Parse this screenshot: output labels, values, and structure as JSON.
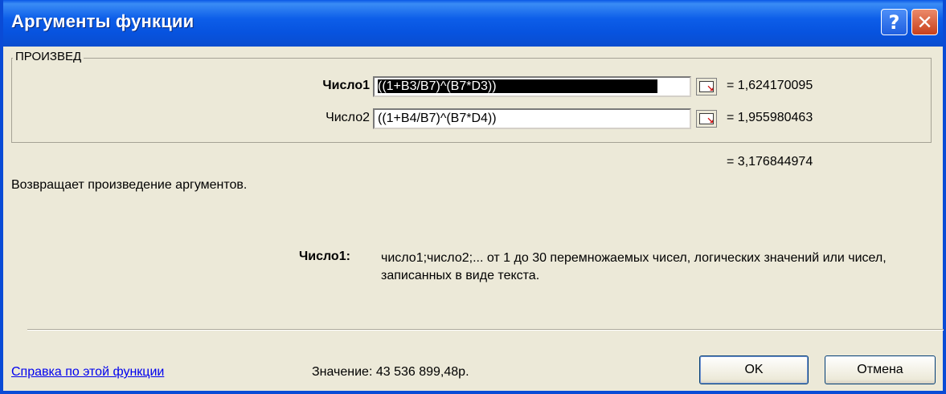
{
  "window": {
    "title": "Аргументы функции"
  },
  "titlebar_buttons": {
    "help": "?",
    "close": "✕"
  },
  "function_group": {
    "name": "ПРОИЗВЕД"
  },
  "arguments": [
    {
      "label": "Число1",
      "formula": "((1+B3/B7)^(B7*D3))",
      "value": "= 1,624170095"
    },
    {
      "label": "Число2",
      "formula": "((1+B4/B7)^(B7*D4))",
      "value": "= 1,955980463"
    }
  ],
  "result": "= 3,176844974",
  "description": "Возвращает произведение аргументов.",
  "hint": {
    "label": "Число1:",
    "text": "число1;число2;... от 1 до 30 перемножаемых чисел, логических значений или чисел, записанных в виде текста."
  },
  "footer": {
    "help_link": "Справка по этой функции",
    "value_label": "Значение: 43 536 899,48р.",
    "ok_label": "OK",
    "cancel_label": "Отмена"
  },
  "colors": {
    "titlebar": "#0d5ee9",
    "dialog_bg": "#ece9d8",
    "link": "#0000ee"
  }
}
